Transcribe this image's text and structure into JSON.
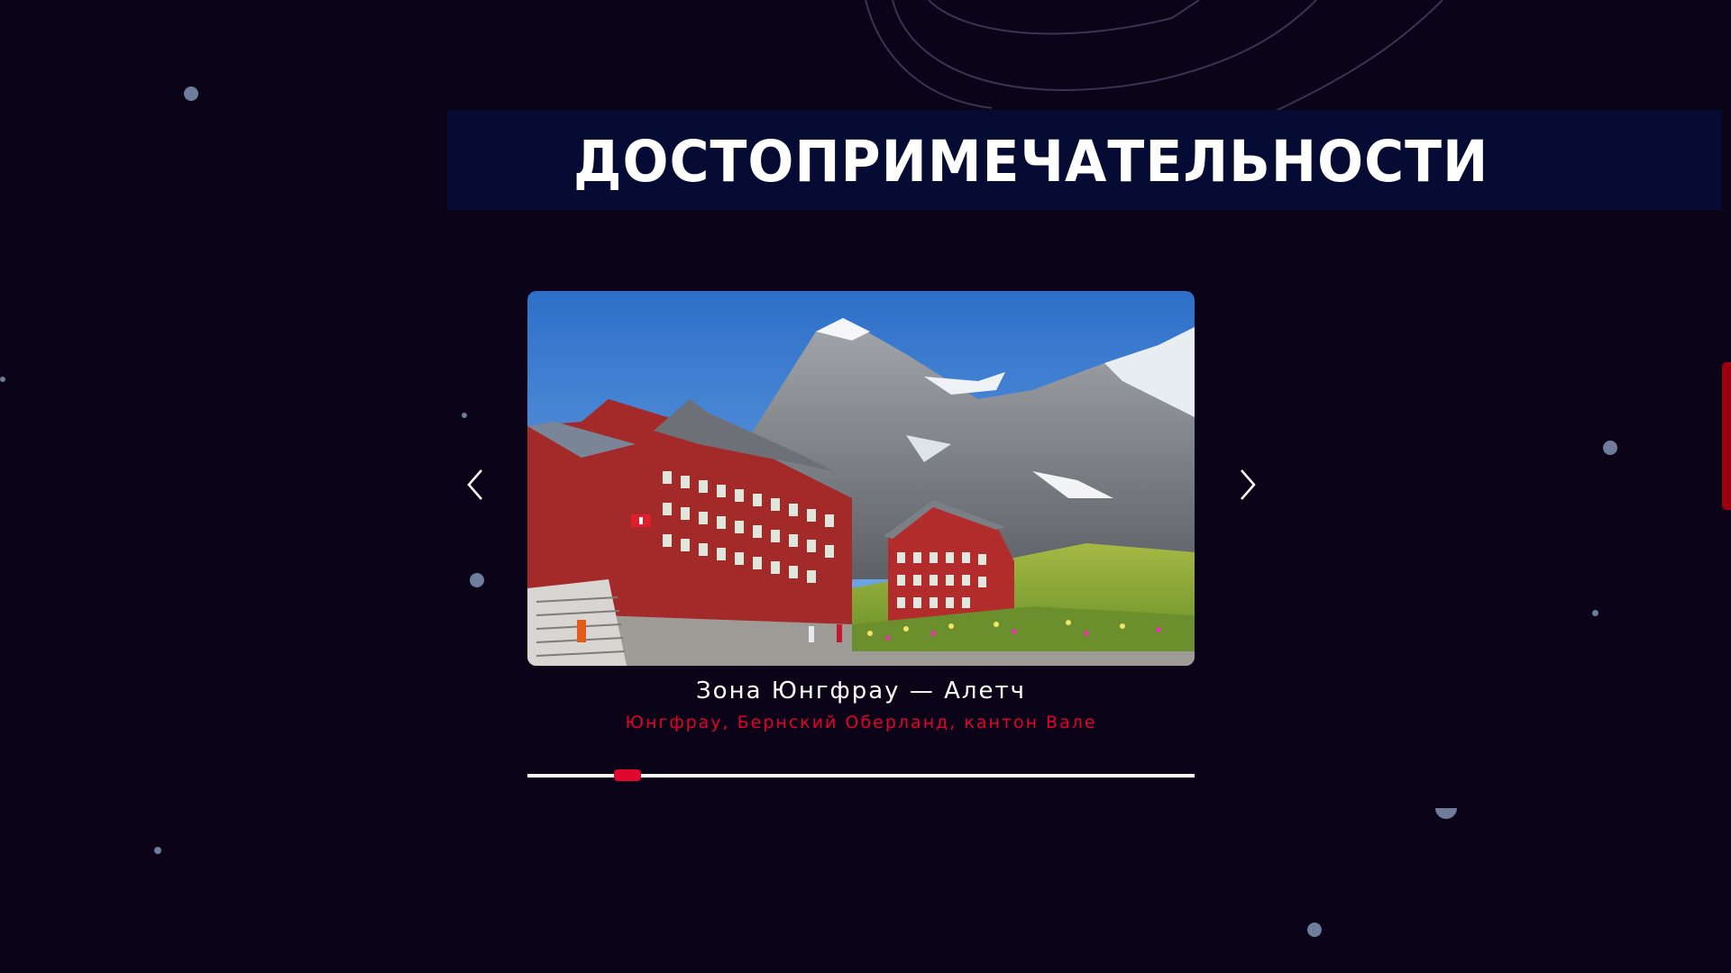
{
  "section": {
    "title": "ДОСТОПРИМЕЧАТЕЛЬНОСТИ"
  },
  "slider": {
    "slide_title": "Зона Юнгфрау — Алетч",
    "slide_subtitle": "Юнгфрау, Бернский Оберланд, кантон Вале",
    "prev_icon": "chevron-left-icon",
    "next_icon": "chevron-right-icon",
    "progress_fraction": 0.17
  },
  "colors": {
    "background": "#0b0418",
    "title_band": "#050b33",
    "accent_red": "#e3002c",
    "text_white": "#ffffff"
  }
}
